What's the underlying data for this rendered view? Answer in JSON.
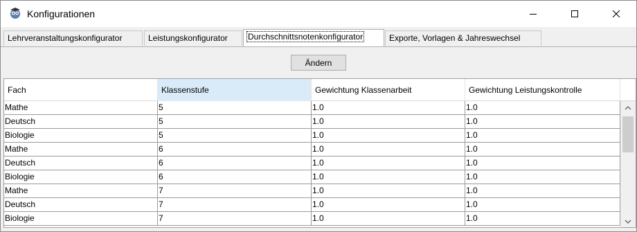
{
  "window": {
    "title": "Konfigurationen",
    "icon": "app-owl-icon"
  },
  "tabs": [
    {
      "label": "Lehrveranstaltungskonfigurator",
      "active": false
    },
    {
      "label": "Leistungskonfigurator",
      "active": false
    },
    {
      "label": "Durchschnittsnotenkonfigurator",
      "active": true
    },
    {
      "label": "Exporte, Vorlagen & Jahreswechsel",
      "active": false
    }
  ],
  "toolbar": {
    "edit_label": "Ändern"
  },
  "table": {
    "columns": [
      "Fach",
      "Klassenstufe",
      "Gewichtung Klassenarbeit",
      "Gewichtung Leistungskontrolle"
    ],
    "rows": [
      [
        "Mathe",
        "5",
        "1.0",
        "1.0"
      ],
      [
        "Deutsch",
        "5",
        "1.0",
        "1.0"
      ],
      [
        "Biologie",
        "5",
        "1.0",
        "1.0"
      ],
      [
        "Mathe",
        "6",
        "1.0",
        "1.0"
      ],
      [
        "Deutsch",
        "6",
        "1.0",
        "1.0"
      ],
      [
        "Biologie",
        "6",
        "1.0",
        "1.0"
      ],
      [
        "Mathe",
        "7",
        "1.0",
        "1.0"
      ],
      [
        "Deutsch",
        "7",
        "1.0",
        "1.0"
      ],
      [
        "Biologie",
        "7",
        "1.0",
        "1.0"
      ]
    ]
  }
}
